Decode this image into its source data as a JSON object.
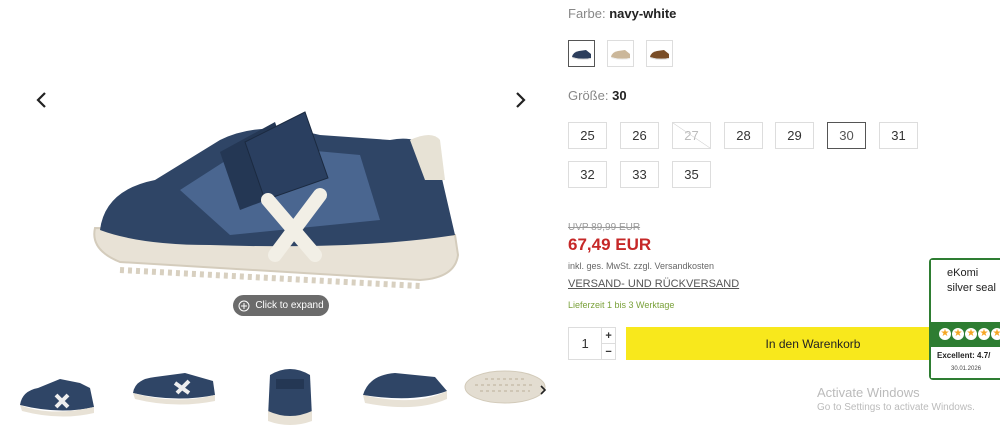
{
  "gallery": {
    "expand_label": "Click to expand",
    "thumbnails": [
      "side-view",
      "angle-view",
      "back-view",
      "top-side-view",
      "sole-view"
    ]
  },
  "product": {
    "color_label": "Farbe:",
    "color_value": "navy-white",
    "swatches": [
      {
        "name": "navy-white",
        "color": "#2c3e5c",
        "selected": true
      },
      {
        "name": "beige",
        "color": "#cbb79a",
        "selected": false
      },
      {
        "name": "brown",
        "color": "#7a4e27",
        "selected": false
      }
    ],
    "size_label": "Größe:",
    "size_value": "30",
    "sizes": [
      {
        "label": "25",
        "state": "available"
      },
      {
        "label": "26",
        "state": "available"
      },
      {
        "label": "27",
        "state": "disabled"
      },
      {
        "label": "28",
        "state": "available"
      },
      {
        "label": "29",
        "state": "available"
      },
      {
        "label": "30",
        "state": "selected"
      },
      {
        "label": "31",
        "state": "available"
      },
      {
        "label": "32",
        "state": "available"
      },
      {
        "label": "33",
        "state": "available"
      },
      {
        "label": "35",
        "state": "available"
      }
    ],
    "uvp": "UVP 89,99 EUR",
    "price": "67,49 EUR",
    "vat_note": "inkl. ges. MwSt. zzgl. Versandkosten",
    "shipping_link": "VERSAND- UND RÜCKVERSAND",
    "delivery": "Lieferzeit 1 bis 3 Werktage",
    "quantity": "1",
    "qty_plus": "+",
    "qty_minus": "−",
    "cart_label": "In den Warenkorb",
    "accent_color": "#f8e81c",
    "price_color": "#c62828"
  },
  "ekomi": {
    "alt_text": "eKomi silver seal",
    "rating_title": "CUSTOMER RATING",
    "excellent": "Excellent: 4.7/",
    "date": "30.01.2026"
  },
  "os_watermark": {
    "line1": "Activate Windows",
    "line2": "Go to Settings to activate Windows."
  }
}
